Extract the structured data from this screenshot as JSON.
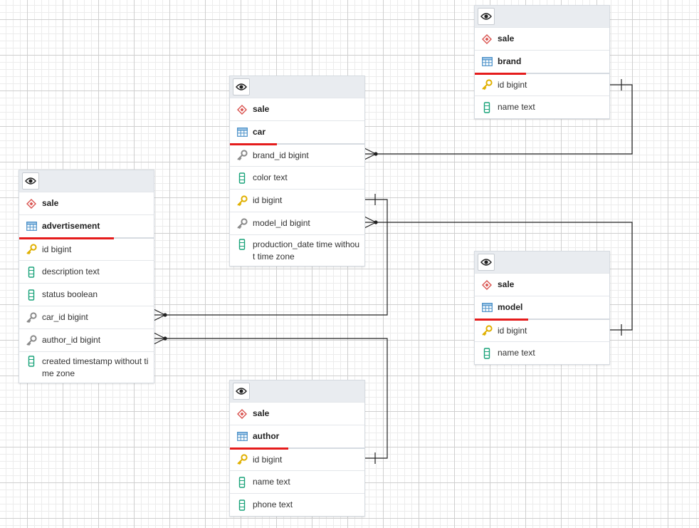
{
  "tables": {
    "brand": {
      "schema": "sale",
      "name": "brand",
      "columns": [
        {
          "label": "id bigint",
          "kind": "pk"
        },
        {
          "label": "name text",
          "kind": "col"
        }
      ]
    },
    "car": {
      "schema": "sale",
      "name": "car",
      "columns": [
        {
          "label": "brand_id bigint",
          "kind": "fk"
        },
        {
          "label": "color text",
          "kind": "col"
        },
        {
          "label": "id bigint",
          "kind": "pk"
        },
        {
          "label": "model_id bigint",
          "kind": "fk"
        },
        {
          "label": "production_date time without time zone",
          "kind": "col"
        }
      ]
    },
    "advertisement": {
      "schema": "sale",
      "name": "advertisement",
      "columns": [
        {
          "label": "id bigint",
          "kind": "pk"
        },
        {
          "label": "description text",
          "kind": "col"
        },
        {
          "label": "status boolean",
          "kind": "col"
        },
        {
          "label": "car_id bigint",
          "kind": "fk"
        },
        {
          "label": "author_id bigint",
          "kind": "fk"
        },
        {
          "label": "created timestamp without time zone",
          "kind": "col"
        }
      ]
    },
    "model": {
      "schema": "sale",
      "name": "model",
      "columns": [
        {
          "label": "id bigint",
          "kind": "pk"
        },
        {
          "label": "name text",
          "kind": "col"
        }
      ]
    },
    "author": {
      "schema": "sale",
      "name": "author",
      "columns": [
        {
          "label": "id bigint",
          "kind": "pk"
        },
        {
          "label": "name text",
          "kind": "col"
        },
        {
          "label": "phone text",
          "kind": "col"
        }
      ]
    }
  },
  "relationships": [
    {
      "from": "car.brand_id",
      "to": "brand.id"
    },
    {
      "from": "car.model_id",
      "to": "model.id"
    },
    {
      "from": "advertisement.car_id",
      "to": "car.id"
    },
    {
      "from": "advertisement.author_id",
      "to": "author.id"
    }
  ],
  "icons": {
    "visibility": "eye-icon",
    "schema": "schema-icon",
    "table": "table-icon",
    "primary_key": "primary-key-icon",
    "foreign_key": "foreign-key-icon",
    "column": "column-icon"
  },
  "colors": {
    "name_underline": "#e51c1c",
    "schema_icon": "#d9534f",
    "table_icon": "#4a90c8",
    "primary_key": "#e0b000",
    "foreign_key": "#8a8a8a",
    "column_icon": "#1aa37a",
    "line": "#222222"
  }
}
